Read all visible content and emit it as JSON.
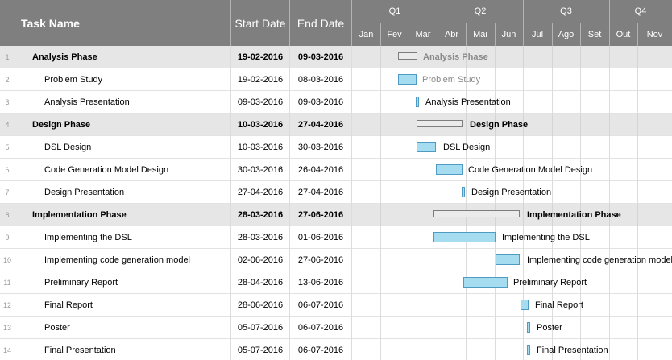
{
  "header": {
    "task_name": "Task Name",
    "start_date": "Start Date",
    "end_date": "End Date",
    "quarters": [
      "Q1",
      "Q2",
      "Q3",
      "Q4"
    ],
    "months": [
      "Jan",
      "Fev",
      "Mar",
      "Abr",
      "Mai",
      "Jun",
      "Jul",
      "Ago",
      "Set",
      "Out",
      "Nov"
    ]
  },
  "tasks": [
    {
      "num": "1",
      "name": "Analysis Phase",
      "start": "19-02-2016",
      "end": "09-03-2016",
      "phase": true,
      "bar_label": "Analysis Phase",
      "bar_type": "summary",
      "label_color": "grey"
    },
    {
      "num": "2",
      "name": "Problem Study",
      "start": "19-02-2016",
      "end": "08-03-2016",
      "phase": false,
      "bar_label": "Problem Study",
      "bar_type": "task",
      "label_color": "grey"
    },
    {
      "num": "3",
      "name": "Analysis Presentation",
      "start": "09-03-2016",
      "end": "09-03-2016",
      "phase": false,
      "bar_label": "Analysis Presentation",
      "bar_type": "milestone",
      "label_color": "black"
    },
    {
      "num": "4",
      "name": "Design Phase",
      "start": "10-03-2016",
      "end": "27-04-2016",
      "phase": true,
      "bar_label": "Design Phase",
      "bar_type": "summary",
      "label_color": "black"
    },
    {
      "num": "5",
      "name": "DSL Design",
      "start": "10-03-2016",
      "end": "30-03-2016",
      "phase": false,
      "bar_label": "DSL Design",
      "bar_type": "task",
      "label_color": "black"
    },
    {
      "num": "6",
      "name": "Code Generation Model Design",
      "start": "30-03-2016",
      "end": "26-04-2016",
      "phase": false,
      "bar_label": "Code Generation Model Design",
      "bar_type": "task",
      "label_color": "black"
    },
    {
      "num": "7",
      "name": "Design Presentation",
      "start": "27-04-2016",
      "end": "27-04-2016",
      "phase": false,
      "bar_label": "Design Presentation",
      "bar_type": "milestone",
      "label_color": "black"
    },
    {
      "num": "8",
      "name": "Implementation Phase",
      "start": "28-03-2016",
      "end": "27-06-2016",
      "phase": true,
      "bar_label": "Implementation Phase",
      "bar_type": "summary",
      "label_color": "black"
    },
    {
      "num": "9",
      "name": "Implementing the DSL",
      "start": "28-03-2016",
      "end": "01-06-2016",
      "phase": false,
      "bar_label": "Implementing the DSL",
      "bar_type": "task",
      "label_color": "black"
    },
    {
      "num": "10",
      "name": "Implementing code generation model",
      "start": "02-06-2016",
      "end": "27-06-2016",
      "phase": false,
      "bar_label": "Implementing code generation model",
      "bar_type": "task",
      "label_color": "black"
    },
    {
      "num": "11",
      "name": "Preliminary Report",
      "start": "28-04-2016",
      "end": "13-06-2016",
      "phase": false,
      "bar_label": "Preliminary Report",
      "bar_type": "task",
      "label_color": "black"
    },
    {
      "num": "12",
      "name": "Final Report",
      "start": "28-06-2016",
      "end": "06-07-2016",
      "phase": false,
      "bar_label": "Final Report",
      "bar_type": "task",
      "label_color": "black"
    },
    {
      "num": "13",
      "name": "Poster",
      "start": "05-07-2016",
      "end": "06-07-2016",
      "phase": false,
      "bar_label": "Poster",
      "bar_type": "milestone",
      "label_color": "black"
    },
    {
      "num": "14",
      "name": "Final Presentation",
      "start": "05-07-2016",
      "end": "06-07-2016",
      "phase": false,
      "bar_label": "Final Presentation",
      "bar_type": "milestone",
      "label_color": "black"
    }
  ],
  "colors": {
    "header_bg": "#7f7f7f",
    "phase_row_bg": "#e6e6e6",
    "task_bar_fill": "#a6dcef",
    "task_bar_border": "#4e9cc4",
    "summary_bar_fill": "#ebebeb"
  }
}
